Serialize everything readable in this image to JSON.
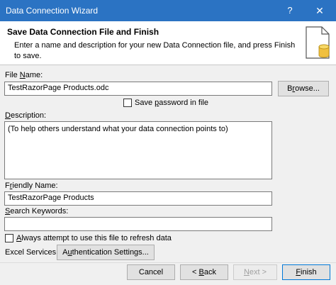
{
  "window": {
    "title": "Data Connection Wizard",
    "help_glyph": "?",
    "close_glyph": "✕"
  },
  "header": {
    "title": "Save Data Connection File and Finish",
    "description": "Enter a name and description for your new Data Connection file, and press Finish to save."
  },
  "file_name": {
    "label_pre": "File ",
    "label_mnemonic": "N",
    "label_post": "ame:",
    "value": "TestRazorPage Products.odc",
    "browse_pre": "B",
    "browse_mnemonic": "r",
    "browse_post": "owse..."
  },
  "save_password": {
    "label_pre": "Save ",
    "label_mnemonic": "p",
    "label_post": "assword in file",
    "checked": false
  },
  "description": {
    "label_mnemonic": "D",
    "label_post": "escription:",
    "value": "(To help others understand what your data connection points to)"
  },
  "friendly_name": {
    "label_pre": "F",
    "label_mnemonic": "r",
    "label_post": "iendly Name:",
    "value": "TestRazorPage Products"
  },
  "search_keywords": {
    "label_mnemonic": "S",
    "label_post": "earch Keywords:",
    "value": ""
  },
  "always_refresh": {
    "label_mnemonic": "A",
    "label_post": "lways attempt to use this file to refresh data",
    "checked": false
  },
  "excel_services": {
    "label": "Excel Services:",
    "auth_pre": "A",
    "auth_mnemonic": "u",
    "auth_post": "thentication Settings..."
  },
  "footer": {
    "cancel": "Cancel",
    "back_pre": "< ",
    "back_mnemonic": "B",
    "back_post": "ack",
    "next_pre": "",
    "next_mnemonic": "N",
    "next_post": "ext >",
    "finish_mnemonic": "F",
    "finish_post": "inish"
  }
}
